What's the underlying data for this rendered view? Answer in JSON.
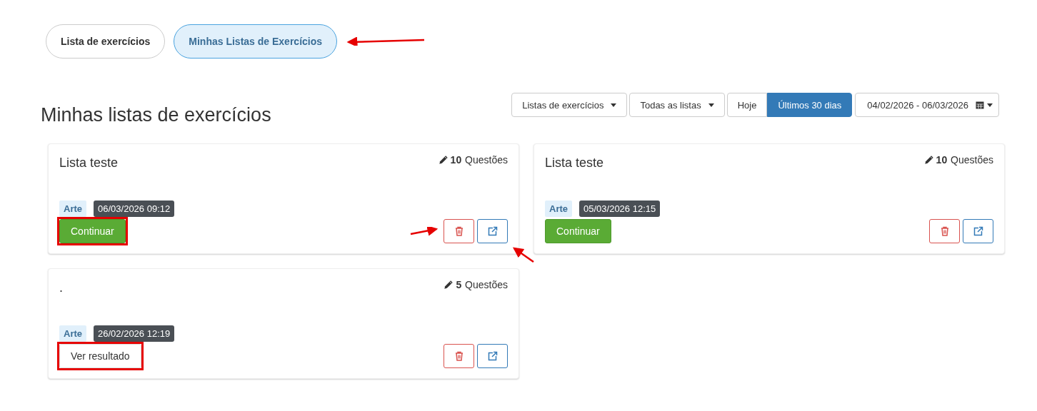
{
  "tabs": [
    {
      "label": "Lista de exercícios",
      "selected": false,
      "pointed": false
    },
    {
      "label": "Minhas Listas de Exercícios",
      "selected": true,
      "pointed": true
    }
  ],
  "heading": "Minhas listas de exercícios",
  "filters": {
    "dropdowns": [
      "Listas de exercícios",
      "Todas as listas"
    ],
    "ranges": [
      {
        "label": "Hoje",
        "selected": false
      },
      {
        "label": "Últimos 30 dias",
        "selected": true
      }
    ],
    "date_range": "04/02/2026 - 06/03/2026"
  },
  "cards": [
    {
      "title": "Lista teste",
      "count": "10",
      "count_label": "Questões",
      "subject": "Arte",
      "date": "06/03/2026 09:12",
      "action": {
        "kind": "continue",
        "label": "Continuar",
        "highlighted": true
      },
      "delete_pointed": true,
      "open_pointed": true
    },
    {
      "title": "Lista teste",
      "count": "10",
      "count_label": "Questões",
      "subject": "Arte",
      "date": "05/03/2026 12:15",
      "action": {
        "kind": "continue",
        "label": "Continuar",
        "highlighted": false
      },
      "delete_pointed": false,
      "open_pointed": false
    },
    {
      "title": ".",
      "count": "5",
      "count_label": "Questões",
      "subject": "Arte",
      "date": "26/02/2026 12:19",
      "action": {
        "kind": "result",
        "label": "Ver resultado",
        "highlighted": true
      },
      "delete_pointed": false,
      "open_pointed": false
    }
  ]
}
